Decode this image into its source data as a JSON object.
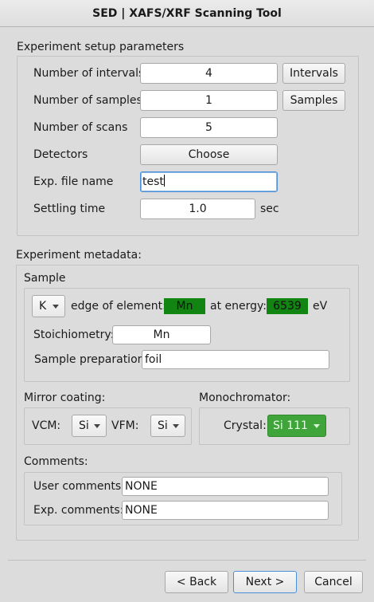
{
  "window": {
    "title": "SED | XAFS/XRF Scanning Tool"
  },
  "setup": {
    "title": "Experiment setup parameters",
    "intervals_label": "Number of intervals",
    "intervals_value": "4",
    "intervals_button": "Intervals",
    "samples_label": "Number of samples",
    "samples_value": "1",
    "samples_button": "Samples",
    "scans_label": "Number of scans",
    "scans_value": "5",
    "detectors_label": "Detectors",
    "detectors_button": "Choose",
    "file_label": "Exp.  file name",
    "file_value": "test",
    "settling_label": "Settling time",
    "settling_value": "1.0",
    "settling_unit": "sec"
  },
  "metadata": {
    "title": "Experiment metadata:",
    "sample": {
      "title": "Sample",
      "edge_value": "K",
      "edge_label": "edge of element:",
      "element_value": "Mn",
      "energy_label": "at energy:",
      "energy_value": "6539",
      "energy_unit": "eV",
      "stoich_label": "Stoichiometry:",
      "stoich_value": "Mn",
      "prep_label": "Sample preparation:",
      "prep_value": "foil"
    },
    "mirror": {
      "title": "Mirror coating:",
      "vcm_label": "VCM:",
      "vcm_value": "Si",
      "vfm_label": "VFM:",
      "vfm_value": "Si"
    },
    "mono": {
      "title": "Monochromator:",
      "crystal_label": "Crystal:",
      "crystal_value": "Si 111"
    },
    "comments": {
      "title": "Comments:",
      "user_label": "User comments:",
      "user_value": "NONE",
      "exp_label": "Exp. comments:",
      "exp_value": "NONE"
    }
  },
  "footer": {
    "back_label": "< Back",
    "next_label": "Next >",
    "cancel_label": "Cancel"
  }
}
